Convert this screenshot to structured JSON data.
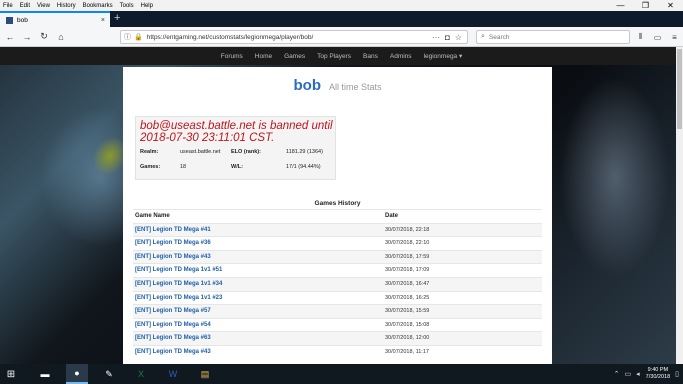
{
  "menu": [
    "File",
    "Edit",
    "View",
    "History",
    "Bookmarks",
    "Tools",
    "Help"
  ],
  "window_controls": {
    "minimize": "—",
    "restore": "❐",
    "close": "✕"
  },
  "tab": {
    "title": "bob",
    "close": "×",
    "new_tab": "+"
  },
  "nav": {
    "back": "←",
    "forward": "→",
    "reload": "↻",
    "home": "⌂",
    "url": "https://entgaming.net/customstats/legionmega/player/bob/",
    "page_actions": "···",
    "search_placeholder": "Search",
    "library": "⫴",
    "sidebar": "▭",
    "menu": "≡"
  },
  "site_nav": [
    "Forums",
    "Home",
    "Games",
    "Top Players",
    "Bans",
    "Admins",
    "legionmega ▾"
  ],
  "player": {
    "name": "bob",
    "subtitle": "All time Stats"
  },
  "ban_message": "bob@useast.battle.net is banned until 2018-07-30 23:11:01 CST.",
  "stats": {
    "realm_label": "Realm:",
    "realm": "useast.battle.net",
    "elo_label": "ELO (rank):",
    "elo": "1181.29 (1364)",
    "games_label": "Games:",
    "games": "18",
    "wl_label": "W/L:",
    "wl": "17/1 (94.44%)"
  },
  "history": {
    "title": "Games History",
    "columns": [
      "Game Name",
      "Date"
    ],
    "rows": [
      [
        "[ENT] Legion TD Mega #41",
        "30/07/2018, 22:18"
      ],
      [
        "[ENT] Legion TD Mega #36",
        "30/07/2018, 22:10"
      ],
      [
        "[ENT] Legion TD Mega #43",
        "30/07/2018, 17:59"
      ],
      [
        "[ENT] Legion TD Mega 1v1 #51",
        "30/07/2018, 17:09"
      ],
      [
        "[ENT] Legion TD Mega 1v1 #34",
        "30/07/2018, 16:47"
      ],
      [
        "[ENT] Legion TD Mega 1v1 #23",
        "30/07/2018, 16:25"
      ],
      [
        "[ENT] Legion TD Mega #57",
        "30/07/2018, 15:59"
      ],
      [
        "[ENT] Legion TD Mega #54",
        "30/07/2018, 15:08"
      ],
      [
        "[ENT] Legion TD Mega #63",
        "30/07/2018, 12:00"
      ],
      [
        "[ENT] Legion TD Mega #43",
        "30/07/2018, 11:17"
      ]
    ]
  },
  "taskbar": {
    "time": "9:40 PM",
    "date": "7/30/2018",
    "apps": [
      "start-menu",
      "terminal",
      "firefox",
      "pen-tool",
      "excel",
      "word",
      "file-explorer"
    ]
  }
}
